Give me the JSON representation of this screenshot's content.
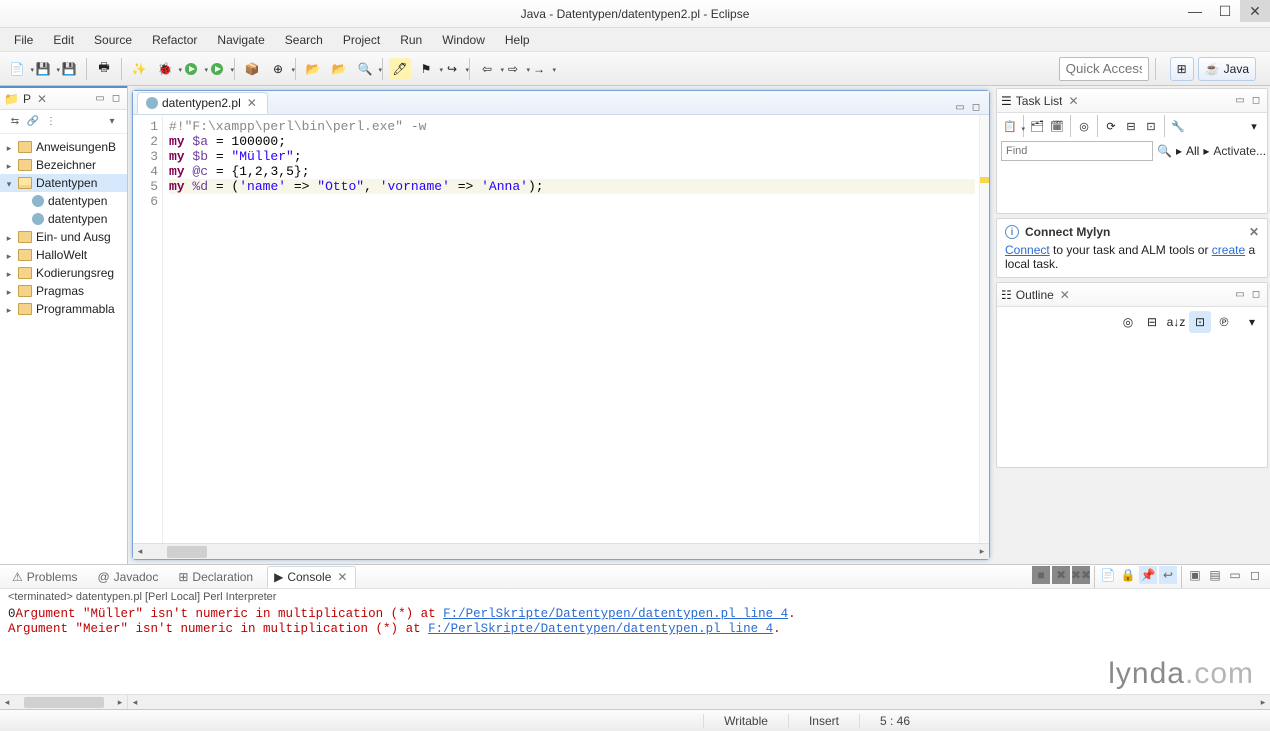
{
  "window": {
    "title": "Java - Datentypen/datentypen2.pl - Eclipse"
  },
  "menu": [
    "File",
    "Edit",
    "Source",
    "Refactor",
    "Navigate",
    "Search",
    "Project",
    "Run",
    "Window",
    "Help"
  ],
  "quick_access_placeholder": "Quick Access",
  "perspectives": {
    "java_label": "Java"
  },
  "explorer": {
    "tab_label": "P",
    "items": [
      {
        "label": "AnweisungenB",
        "type": "folder"
      },
      {
        "label": "Bezeichner",
        "type": "folder"
      },
      {
        "label": "Datentypen",
        "type": "folder-open",
        "open": true,
        "selected": true
      },
      {
        "label": "datentypen",
        "type": "perl",
        "depth": 1
      },
      {
        "label": "datentypen",
        "type": "perl",
        "depth": 1
      },
      {
        "label": "Ein- und Ausg",
        "type": "folder"
      },
      {
        "label": "HalloWelt",
        "type": "folder"
      },
      {
        "label": "Kodierungsreg",
        "type": "folder"
      },
      {
        "label": "Pragmas",
        "type": "folder"
      },
      {
        "label": "Programmabla",
        "type": "folder"
      }
    ]
  },
  "editor": {
    "tab_label": "datentypen2.pl",
    "lines": [
      {
        "n": 1,
        "segments": [
          {
            "t": "#!\"F:\\xampp\\perl\\bin\\perl.exe\" -w",
            "c": "tok-comment"
          }
        ]
      },
      {
        "n": 2,
        "segments": [
          {
            "t": "my ",
            "c": "tok-kw"
          },
          {
            "t": "$a",
            "c": "tok-var"
          },
          {
            "t": " = ",
            "c": "tok-op"
          },
          {
            "t": "100000",
            "c": "tok-num"
          },
          {
            "t": ";",
            "c": "tok-op"
          }
        ]
      },
      {
        "n": 3,
        "segments": [
          {
            "t": "my ",
            "c": "tok-kw"
          },
          {
            "t": "$b",
            "c": "tok-var"
          },
          {
            "t": " = ",
            "c": "tok-op"
          },
          {
            "t": "\"Müller\"",
            "c": "tok-str"
          },
          {
            "t": ";",
            "c": "tok-op"
          }
        ]
      },
      {
        "n": 4,
        "segments": [
          {
            "t": "my ",
            "c": "tok-kw"
          },
          {
            "t": "@c",
            "c": "tok-var"
          },
          {
            "t": " = {",
            "c": "tok-op"
          },
          {
            "t": "1",
            "c": "tok-num"
          },
          {
            "t": ",",
            "c": "tok-op"
          },
          {
            "t": "2",
            "c": "tok-num"
          },
          {
            "t": ",",
            "c": "tok-op"
          },
          {
            "t": "3",
            "c": "tok-num"
          },
          {
            "t": ",",
            "c": "tok-op"
          },
          {
            "t": "5",
            "c": "tok-num"
          },
          {
            "t": "};",
            "c": "tok-op"
          }
        ]
      },
      {
        "n": 5,
        "current": true,
        "segments": [
          {
            "t": "my ",
            "c": "tok-kw"
          },
          {
            "t": "%d",
            "c": "tok-var"
          },
          {
            "t": " = (",
            "c": "tok-op"
          },
          {
            "t": "'name'",
            "c": "tok-str"
          },
          {
            "t": " => ",
            "c": "tok-op"
          },
          {
            "t": "\"Otto\"",
            "c": "tok-str"
          },
          {
            "t": ", ",
            "c": "tok-op"
          },
          {
            "t": "'vorname'",
            "c": "tok-str"
          },
          {
            "t": " => ",
            "c": "tok-op"
          },
          {
            "t": "'Anna'",
            "c": "tok-str"
          },
          {
            "t": ");",
            "c": "tok-op"
          }
        ]
      },
      {
        "n": 6,
        "segments": []
      }
    ]
  },
  "tasklist": {
    "tab_label": "Task List",
    "find_placeholder": "Find",
    "all_label": "All",
    "activate_label": "Activate..."
  },
  "mylyn": {
    "title": "Connect Mylyn",
    "text_pre": "",
    "connect": "Connect",
    "text_mid": " to your task and ALM tools or ",
    "create": "create",
    "text_post": " a local task."
  },
  "outline": {
    "tab_label": "Outline"
  },
  "bottom": {
    "tabs": [
      "Problems",
      "Javadoc",
      "Declaration",
      "Console"
    ],
    "active": 3,
    "console_title": "<terminated> datentypen.pl [Perl Local] Perl Interpreter",
    "lines": [
      {
        "pre": "0",
        "text": "Argument \"Müller\" isn't numeric in multiplication (*) at ",
        "link": "F:/PerlSkripte/Datentypen/datentypen.pl line 4",
        "end": "."
      },
      {
        "pre": "",
        "text": "Argument \"Meier\" isn't numeric in multiplication (*) at ",
        "link": "F:/PerlSkripte/Datentypen/datentypen.pl line 4",
        "end": "."
      }
    ]
  },
  "status": {
    "writable": "Writable",
    "insert": "Insert",
    "pos": "5 : 46"
  },
  "watermark": "lynda.com"
}
